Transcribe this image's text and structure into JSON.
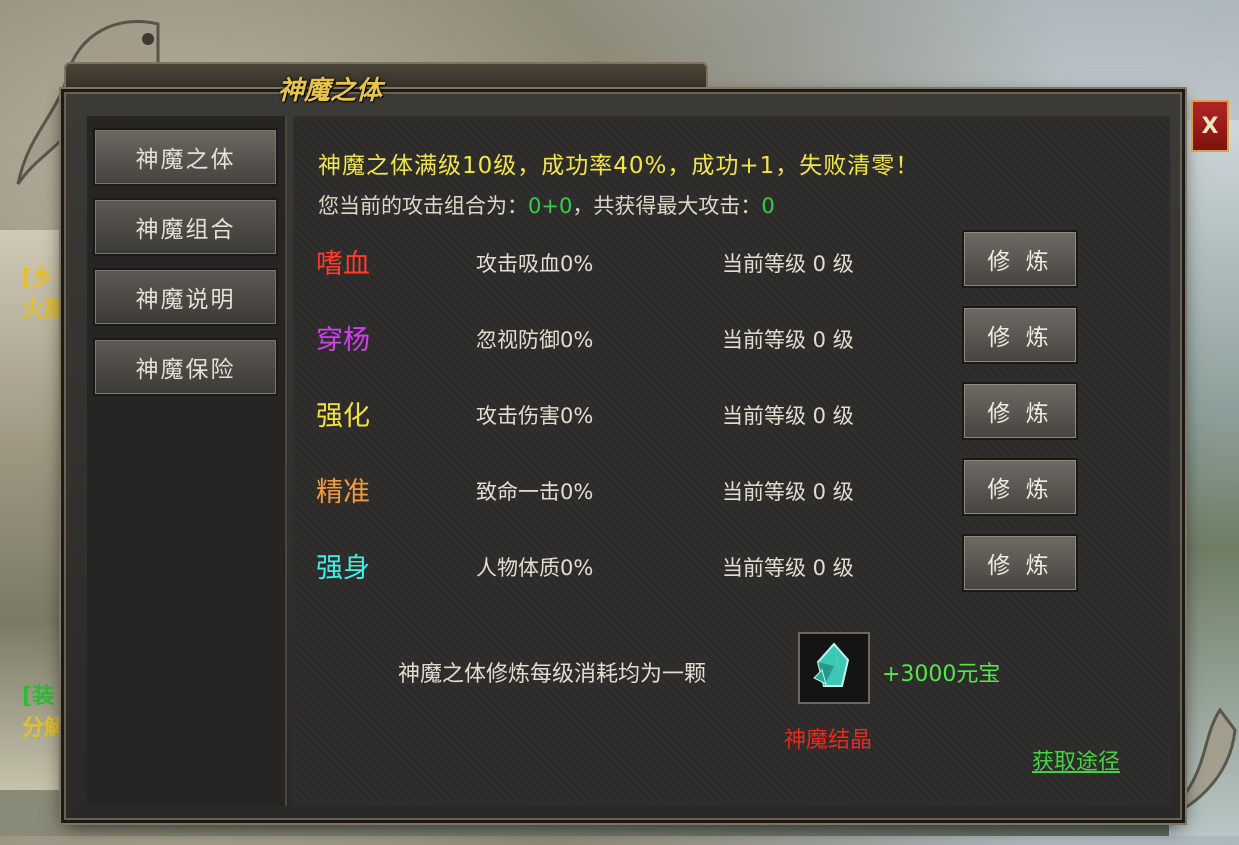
{
  "window": {
    "title": "神魔之体",
    "close_label": "X"
  },
  "background": {
    "left_text_1": "[乡",
    "left_text_2": "火履",
    "left_text_3": "[装",
    "left_text_4": "分解"
  },
  "sidebar": {
    "tabs": [
      {
        "label": "神魔之体",
        "active": true
      },
      {
        "label": "神魔组合",
        "active": false
      },
      {
        "label": "神魔说明",
        "active": false
      },
      {
        "label": "神魔保险",
        "active": false
      }
    ]
  },
  "main": {
    "headline": "神魔之体满级10级，成功率40%，成功+1，失败清零！",
    "combo_prefix": "您当前的攻击组合为：",
    "combo_value": "0+0",
    "combo_mid": "，共获得最大攻击：",
    "max_attack": "0",
    "skills": [
      {
        "name": "嗜血",
        "effect": "攻击吸血0%",
        "level": "当前等级 0 级",
        "button": "修 炼",
        "color": "#ff3b2a"
      },
      {
        "name": "穿杨",
        "effect": "忽视防御0%",
        "level": "当前等级 0 级",
        "button": "修 炼",
        "color": "#d23ff2"
      },
      {
        "name": "强化",
        "effect": "攻击伤害0%",
        "level": "当前等级 0 级",
        "button": "修 炼",
        "color": "#f5e33c"
      },
      {
        "name": "精准",
        "effect": "致命一击0%",
        "level": "当前等级 0 级",
        "button": "修 炼",
        "color": "#f59a3c"
      },
      {
        "name": "强身",
        "effect": "人物体质0%",
        "level": "当前等级 0 级",
        "button": "修 炼",
        "color": "#3ff0ea"
      }
    ],
    "cost_text": "神魔之体修炼每级消耗均为一颗",
    "cost_amount": "+3000元宝",
    "item_icon": "crystal-icon",
    "item_name": "神魔结晶",
    "obtain_link": "获取途径"
  }
}
